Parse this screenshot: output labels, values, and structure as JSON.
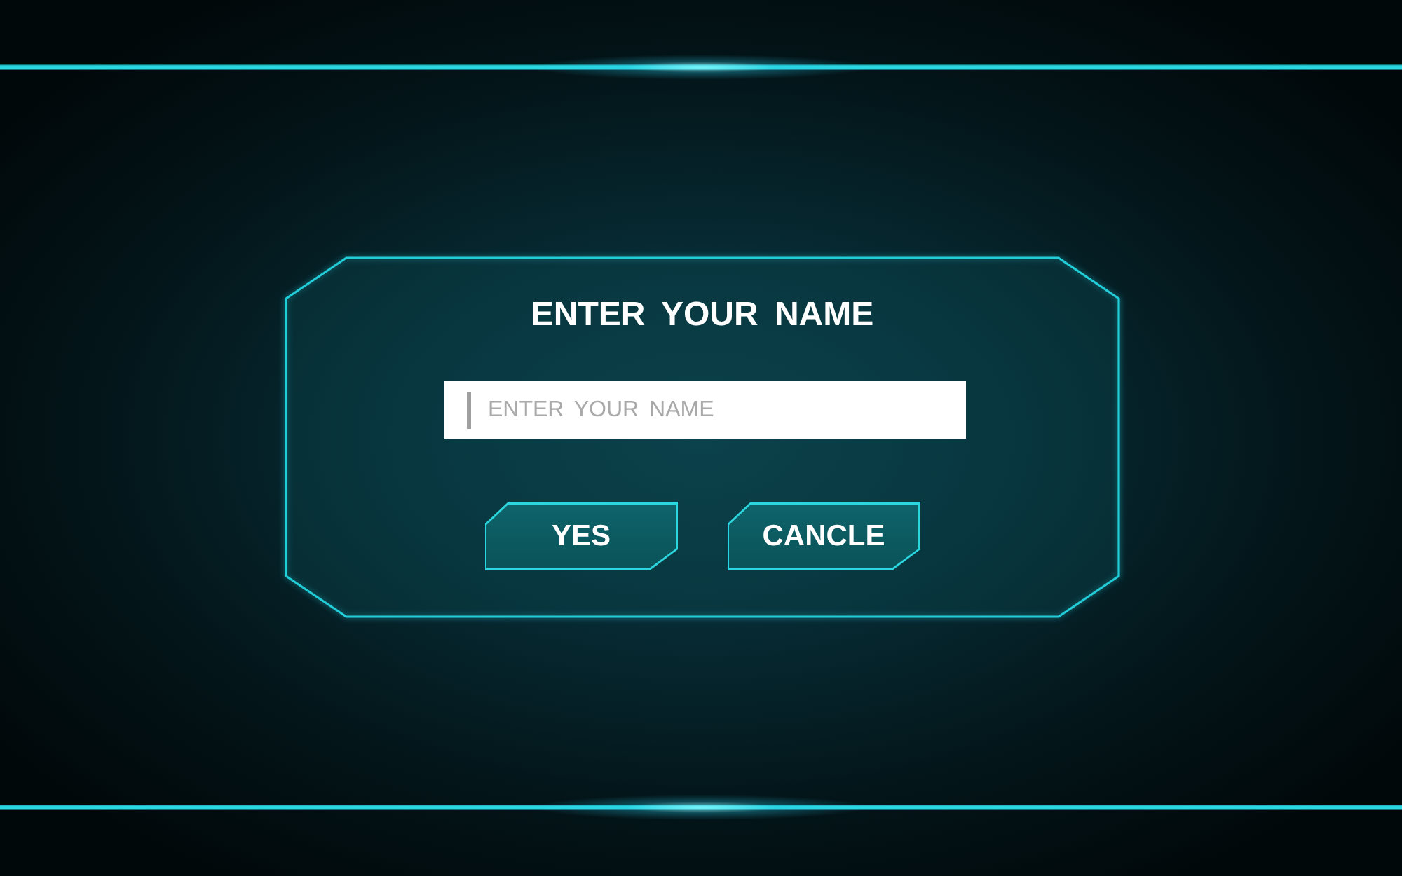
{
  "dialog": {
    "title": "ENTER YOUR NAME",
    "input": {
      "placeholder": "ENTER YOUR NAME",
      "focused": true
    },
    "buttons": [
      {
        "label": "YES"
      },
      {
        "label": "CANCLE"
      }
    ]
  }
}
